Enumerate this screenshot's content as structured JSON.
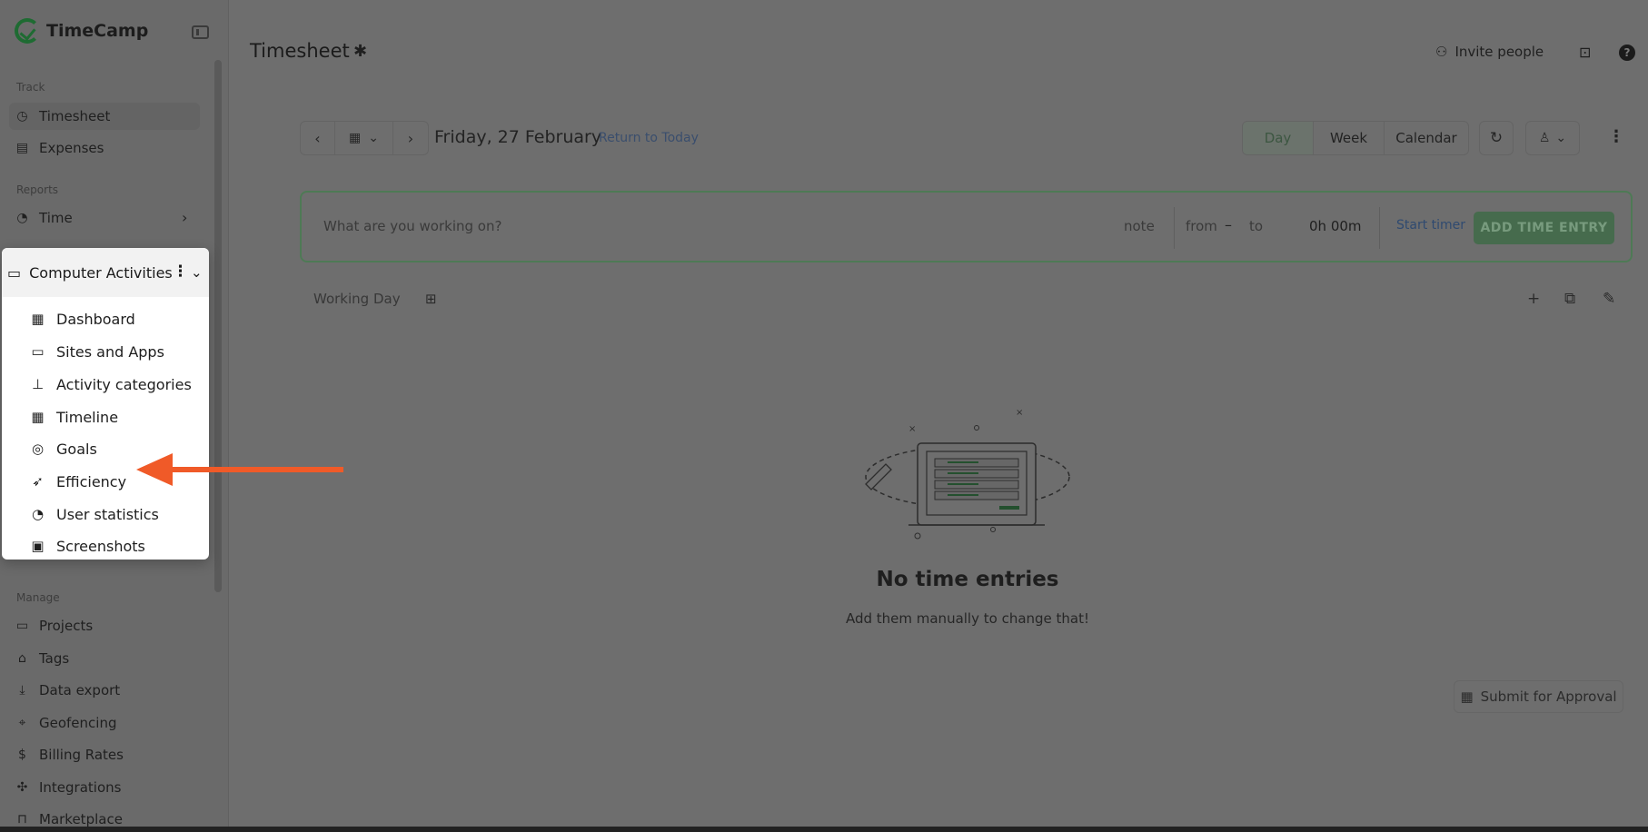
{
  "app": {
    "name": "TimeCamp"
  },
  "sidebar": {
    "sections": {
      "track": "Track",
      "reports": "Reports",
      "manage": "Manage"
    },
    "track_items": [
      {
        "label": "Timesheet",
        "icon": "clock-icon",
        "active": true
      },
      {
        "label": "Expenses",
        "icon": "receipt-icon"
      }
    ],
    "reports_items": [
      {
        "label": "Time",
        "icon": "pie-chart-icon"
      }
    ],
    "manage_items": [
      {
        "label": "Projects",
        "icon": "folder-icon"
      },
      {
        "label": "Tags",
        "icon": "tag-icon"
      },
      {
        "label": "Data export",
        "icon": "download-icon"
      },
      {
        "label": "Geofencing",
        "icon": "map-icon"
      },
      {
        "label": "Billing Rates",
        "icon": "dollar-icon"
      },
      {
        "label": "Integrations",
        "icon": "puzzle-icon"
      },
      {
        "label": "Marketplace",
        "icon": "bag-icon"
      }
    ]
  },
  "popup": {
    "title": "Computer Activities",
    "items": [
      {
        "label": "Dashboard",
        "icon": "dashboard-icon"
      },
      {
        "label": "Sites and Apps",
        "icon": "laptop-icon"
      },
      {
        "label": "Activity categories",
        "icon": "hierarchy-icon"
      },
      {
        "label": "Timeline",
        "icon": "calendar-grid-icon"
      },
      {
        "label": "Goals",
        "icon": "target-icon"
      },
      {
        "label": "Efficiency",
        "icon": "rocket-icon"
      },
      {
        "label": "User statistics",
        "icon": "pie-chart-icon"
      },
      {
        "label": "Screenshots",
        "icon": "image-icon"
      }
    ]
  },
  "header": {
    "title": "Timesheet",
    "invite_label": "Invite people"
  },
  "date_bar": {
    "date": "Friday, 27 February",
    "return_link": "Return to Today",
    "views": [
      "Day",
      "Week",
      "Calendar"
    ],
    "selected_view": "Day"
  },
  "entry": {
    "placeholder": "What are you working on?",
    "note": "note",
    "from": "from",
    "dash": "–",
    "to": "to",
    "duration": "0h 00m",
    "start_timer": "Start timer",
    "add_button": "ADD TIME ENTRY"
  },
  "working_day": {
    "label": "Working Day"
  },
  "empty_state": {
    "title": "No time entries",
    "subtitle": "Add them manually to change that!"
  },
  "submit": {
    "label": "Submit for Approval"
  },
  "colors": {
    "overlay_bg": "#6e6e6e",
    "brand_green": "#1e6b32",
    "annotation_arrow": "#f05a28"
  }
}
